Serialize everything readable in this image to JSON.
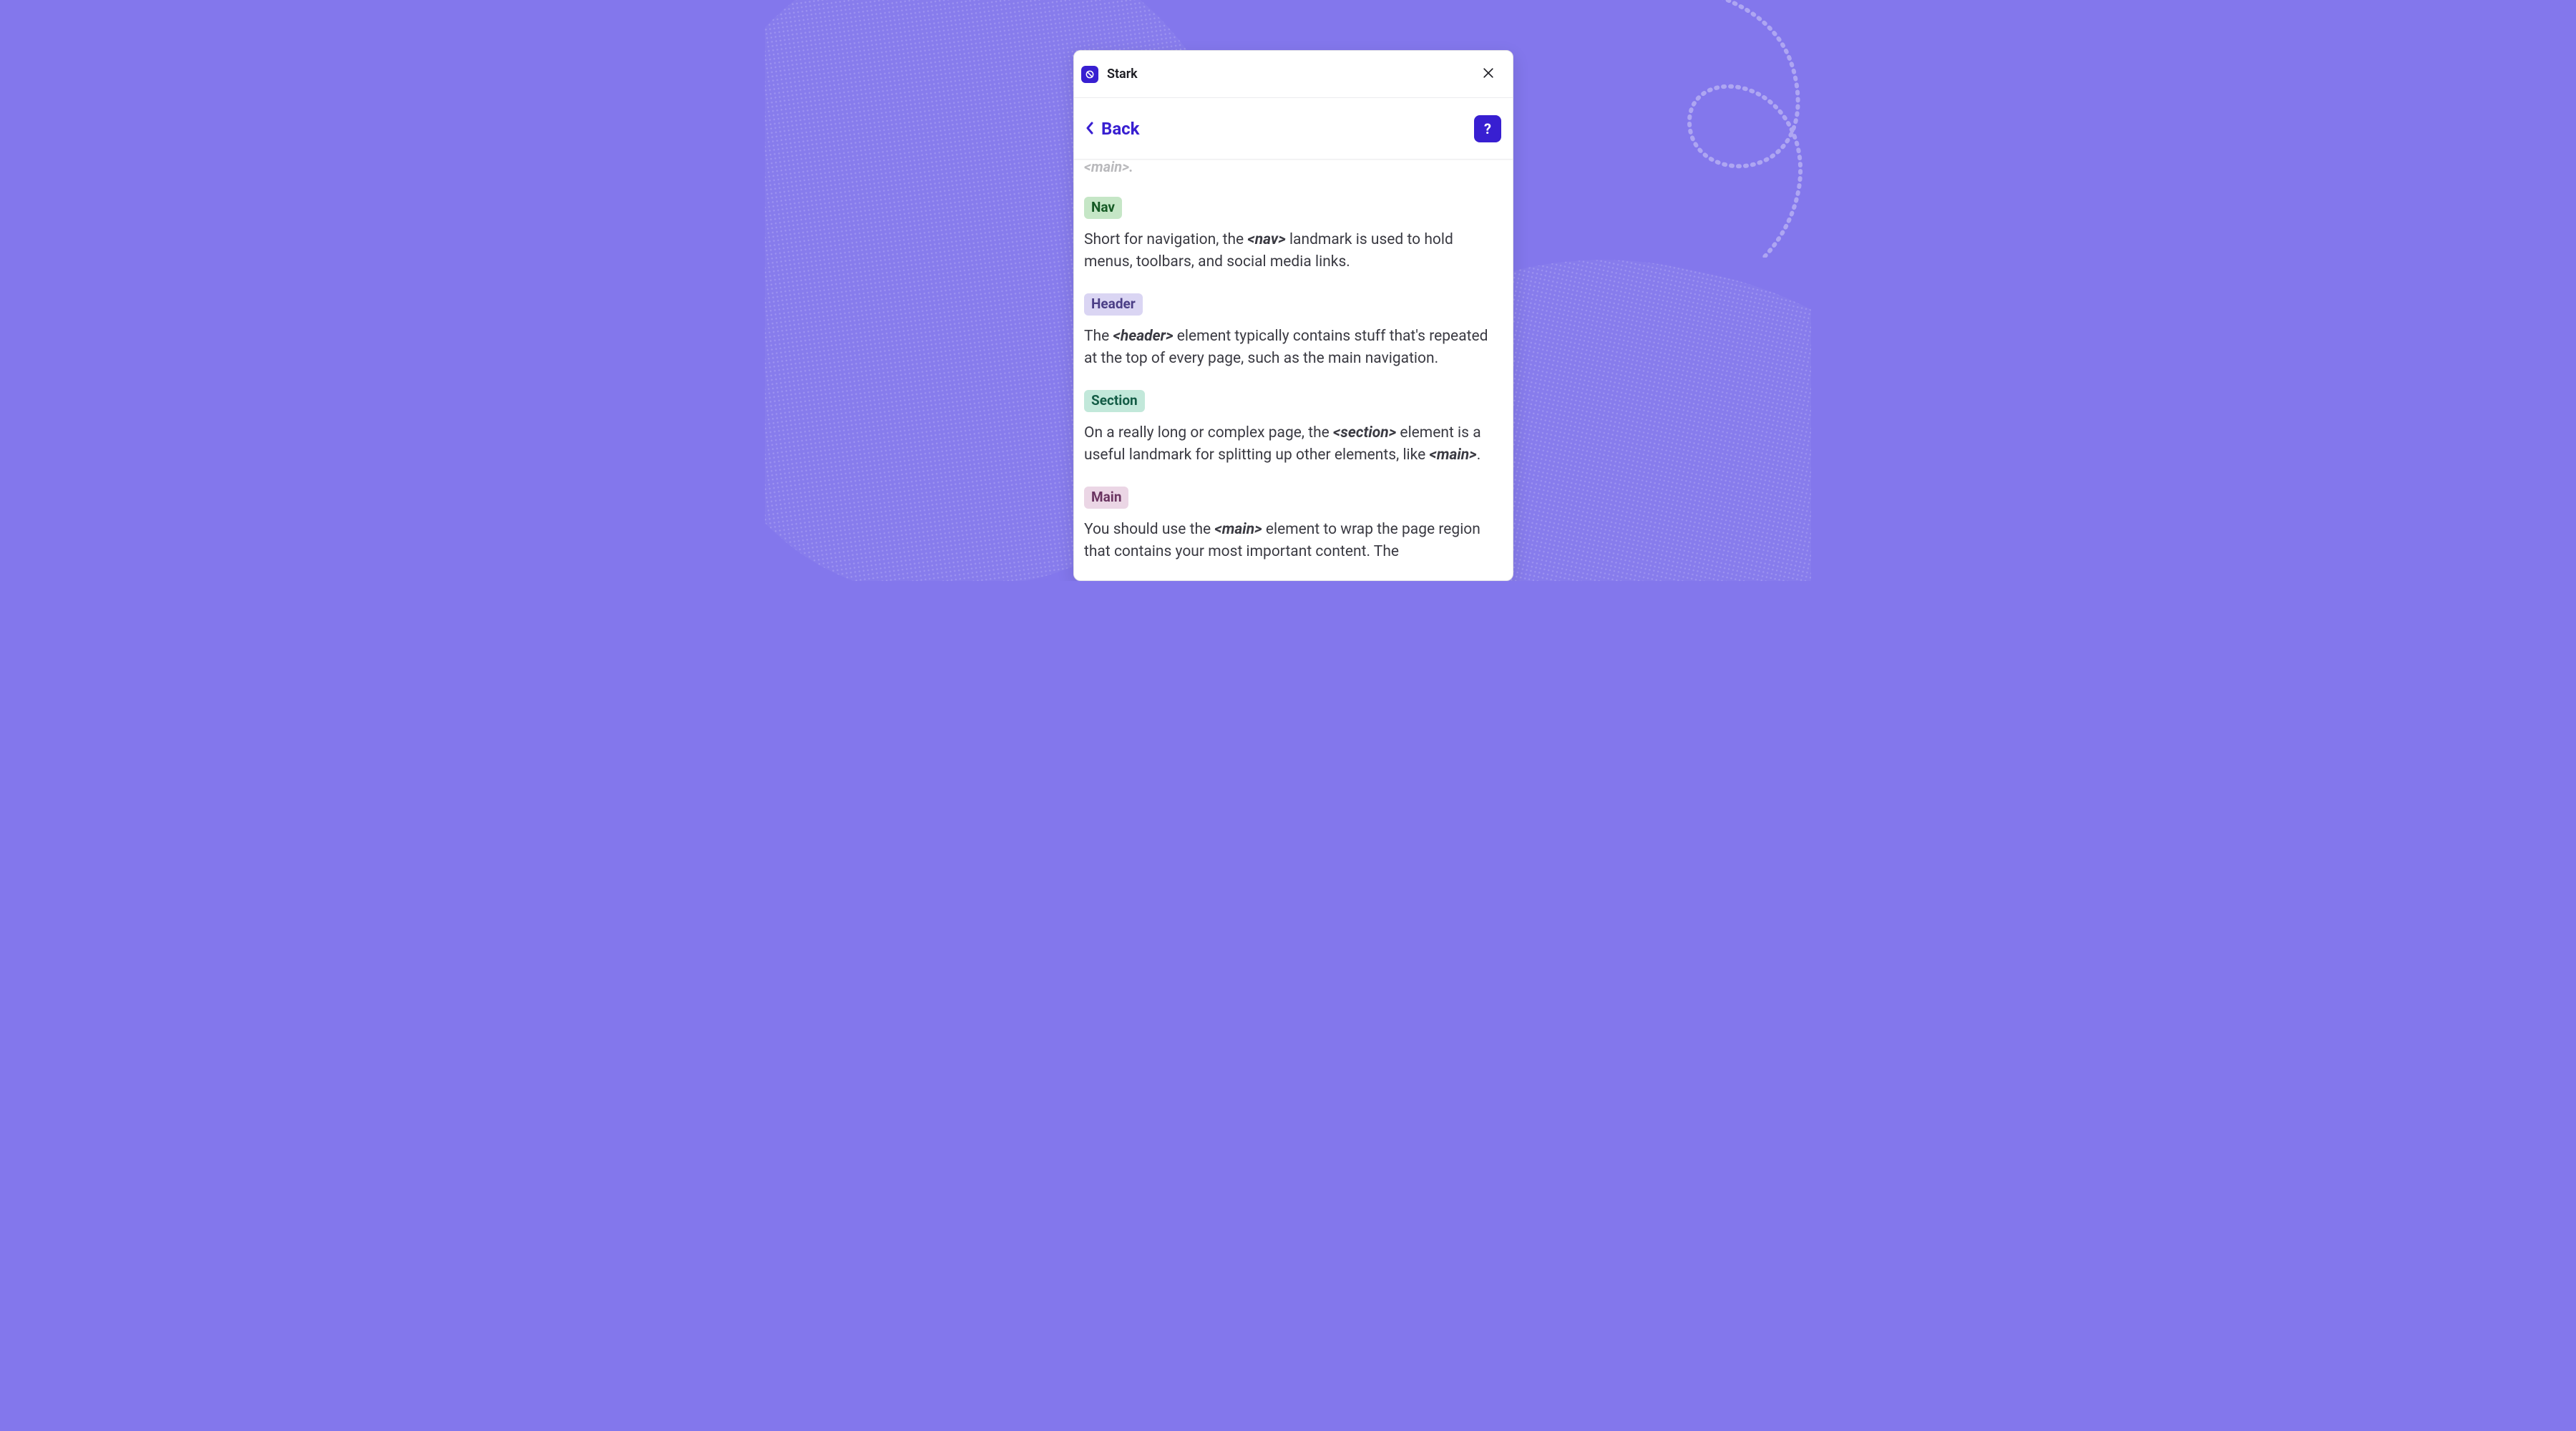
{
  "app": {
    "title": "Stark"
  },
  "toolbar": {
    "back_label": "Back",
    "help_label": "?"
  },
  "peek_text": "<main>.",
  "entries": [
    {
      "key": "nav",
      "label": "Nav",
      "variant": "green",
      "desc_pre": "Short for navigation, the ",
      "code": "<nav>",
      "desc_post": " landmark is used to hold menus, toolbars, and social media links."
    },
    {
      "key": "header",
      "label": "Header",
      "variant": "purple",
      "desc_pre": "The ",
      "code": "<header>",
      "desc_post": " element typically contains stuff that's repeated at the top of every page, such as the main navigation."
    },
    {
      "key": "section",
      "label": "Section",
      "variant": "teal",
      "desc_pre": "On a really long or complex page, the ",
      "code": "<section>",
      "desc_post": " element is a useful landmark for splitting up other elements, like ",
      "code2": "<main>",
      "desc_post2": "."
    },
    {
      "key": "main",
      "label": "Main",
      "variant": "pink",
      "desc_pre": "You should use the ",
      "code": "<main>",
      "desc_post": " element to wrap the page region that contains your most important content. The"
    }
  ],
  "colors": {
    "accent": "#381FD1",
    "bg": "#8377EC"
  }
}
